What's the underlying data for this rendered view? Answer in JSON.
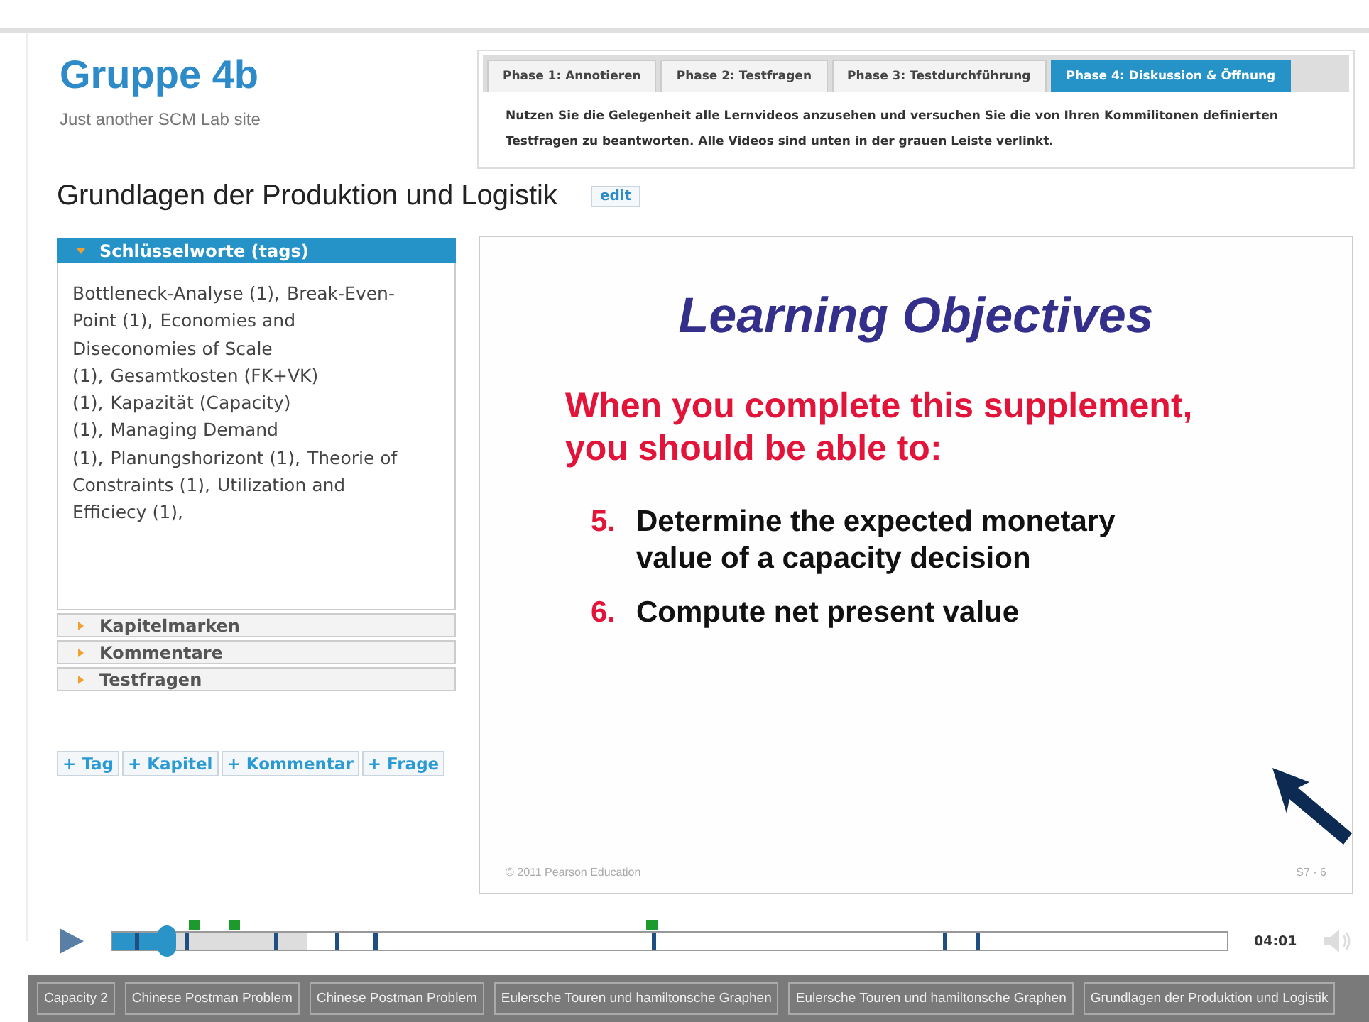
{
  "site": {
    "title": "Gruppe 4b",
    "tagline": "Just another SCM Lab site"
  },
  "phases": {
    "tabs": [
      {
        "label": "Phase 1: Annotieren",
        "selected": false
      },
      {
        "label": "Phase 2: Testfragen",
        "selected": false
      },
      {
        "label": "Phase 3: Testdurchführung",
        "selected": false
      },
      {
        "label": "Phase 4: Diskussion & Öffnung",
        "selected": true
      }
    ],
    "description": "Nutzen Sie die Gelegenheit alle Lernvideos anzusehen und versuchen Sie die von Ihren Kommilitonen definierten Testfragen zu beantworten. Alle Videos sind unten in der grauen Leiste verlinkt."
  },
  "page": {
    "title": "Grundlagen der Produktion und Logistik",
    "edit": "edit"
  },
  "accordion": [
    {
      "label": "Schlüsselworte (tags)",
      "expanded": true,
      "tags": [
        "Bottleneck-Analyse (1),",
        "Break-Even-Point (1),",
        "Economies and Diseconomies of Scale (1),",
        "Gesamtkosten (FK+VK) (1),",
        "Kapazität (Capacity) (1),",
        "Managing Demand (1),",
        "Planungshorizont (1),",
        "Theorie of Constraints (1),",
        "Utilization and Efficiecy (1),"
      ]
    },
    {
      "label": "Kapitelmarken",
      "expanded": false
    },
    {
      "label": "Kommentare",
      "expanded": false
    },
    {
      "label": "Testfragen",
      "expanded": false
    }
  ],
  "add_buttons": [
    "+ Tag",
    "+ Kapitel",
    "+ Kommentar",
    "+ Frage"
  ],
  "slide": {
    "heading": "Learning Objectives",
    "intro": "When you complete this supplement, you should be able to:",
    "items": [
      {
        "number": "5.",
        "text": "Determine the expected monetary value of a capacity decision"
      },
      {
        "number": "6.",
        "text": "Compute net present value"
      }
    ],
    "footer_left": "© 2011 Pearson Education",
    "footer_right": "S7 - 6"
  },
  "player": {
    "time": "04:01",
    "progress": {
      "level": 0.05
    },
    "buffer": {
      "level": 0.175
    }
  },
  "video_links": [
    "Capacity 2",
    "Chinese Postman Problem",
    "Chinese Postman Problem",
    "Eulersche Touren und hamiltonsche Graphen",
    "Eulersche Touren und hamiltonsche Graphen",
    "Grundlagen der Produktion und Logistik"
  ]
}
